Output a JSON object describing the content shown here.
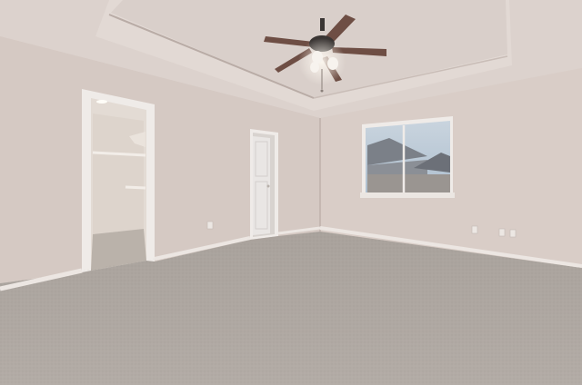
{
  "scene": {
    "subject": "empty-bedroom-interior",
    "colors": {
      "ceiling": "#dcd2cd",
      "tray_ceiling": "#d9cfca",
      "tray_rim": "#e2d9d4",
      "left_wall": "#d5c9c3",
      "back_wall": "#d1c4be",
      "right_wall": "#d9cdc7",
      "baseboard": "#ece6e2",
      "carpet": "#b3aca6",
      "carpet_far": "#a9a29c",
      "door_trim": "#efebe8",
      "door_panel": "#e9e6e4",
      "closet_interior": "#e3dbd4",
      "window_sky": "#aebfcf",
      "window_house": "#8b8f96",
      "fan_blade": "#6e4e44",
      "fan_motor": "#3a3533",
      "fan_light": "#f7f3ee"
    }
  }
}
